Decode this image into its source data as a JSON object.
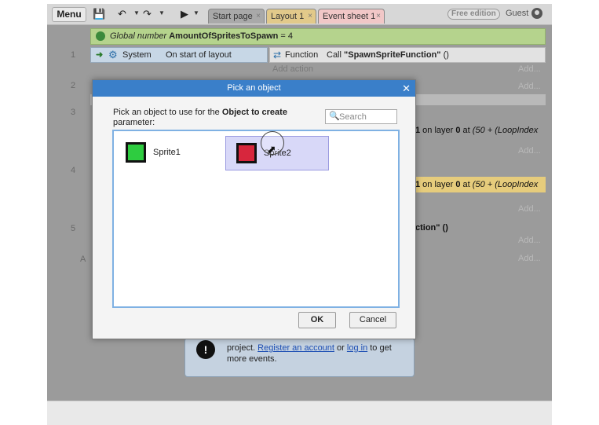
{
  "toolbar": {
    "menu_label": "Menu",
    "tabs": [
      {
        "label": "Start page"
      },
      {
        "label": "Layout 1"
      },
      {
        "label": "Event sheet 1"
      }
    ],
    "tab_close": "×",
    "edition_badge": "Free edition",
    "user": "Guest"
  },
  "sheet": {
    "global_var": {
      "prefix": "Global number",
      "name": "AmountOfSpritesToSpawn",
      "value": "= 4"
    },
    "event_numbers": [
      "1",
      "2",
      "3",
      "4",
      "5"
    ],
    "event1": {
      "condition_object": "System",
      "condition_text": "On start of layout",
      "action_object": "Function",
      "action_prefix": "Call ",
      "action_name": "\"SpawnSpriteFunction\"",
      "action_suffix": " ()"
    },
    "add_action": "Add action",
    "add_short": "Add...",
    "row3_partial": {
      "a": "1",
      "b": " on layer ",
      "c": "0",
      "d": " at ",
      "e": "(50 + (LoopIndex"
    },
    "row4_partial": {
      "a": "1",
      "b": " on layer ",
      "c": "0",
      "d": " at ",
      "e": "(50 + (LoopIndex"
    },
    "row5_partial": "ction\" ()",
    "left_cut": "A",
    "signin": {
      "icon": "!",
      "line1_prefix": "project. ",
      "register_link": "Register an account",
      "or": " or ",
      "login_link": "log in",
      "line1_suffix": " to get",
      "line2": "more events."
    }
  },
  "dialog": {
    "title": "Pick an object",
    "message_prefix": "Pick an object to use for the ",
    "message_bold": "Object to create",
    "message_suffix": "parameter:",
    "search_placeholder": "Search",
    "objects": [
      {
        "label": "Sprite1",
        "color": "#2ecc40",
        "selected": false
      },
      {
        "label": "Sprite2",
        "color": "#d7263d",
        "selected": true
      }
    ],
    "ok_label": "OK",
    "cancel_label": "Cancel"
  }
}
